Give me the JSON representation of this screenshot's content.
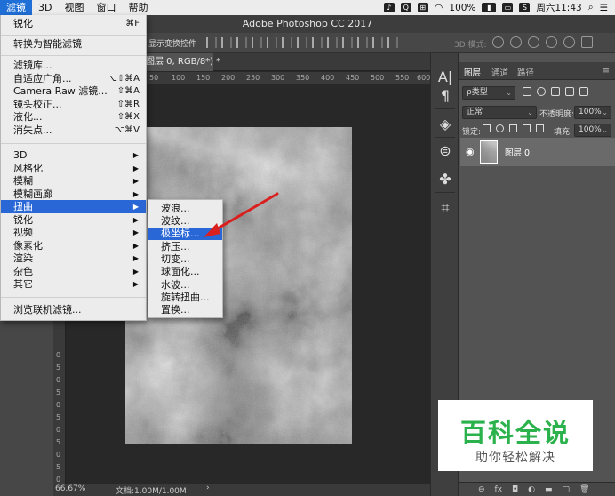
{
  "menubar": {
    "items": [
      {
        "label": "滤镜",
        "active": true
      },
      {
        "label": "3D",
        "active": false
      },
      {
        "label": "视图",
        "active": false
      },
      {
        "label": "窗口",
        "active": false
      },
      {
        "label": "帮助",
        "active": false
      }
    ],
    "battery": "100%",
    "clock": "周六11:43"
  },
  "window": {
    "title": "Adobe Photoshop CC 2017"
  },
  "options": {
    "show_transform": "显示变换控件",
    "mode_3d": "3D 模式:"
  },
  "document": {
    "tab_label": "图层 0, RGB/8*) *",
    "ruler_h": [
      "50",
      "100",
      "150",
      "200",
      "250",
      "300",
      "350",
      "400",
      "450",
      "500",
      "550",
      "600"
    ],
    "ruler_v": [
      "0",
      "5",
      "0",
      "5",
      "0",
      "5",
      "0",
      "5",
      "0",
      "5",
      "0"
    ],
    "zoom": "66.67%",
    "doc_size": "文档:1.00M/1.00M",
    "status_arrow": "›"
  },
  "filter_menu": {
    "items": [
      {
        "label": "锐化",
        "shortcut": "⌘F"
      },
      {
        "label": "转换为智能滤镜",
        "shortcut": ""
      },
      {
        "label": "滤镜库...",
        "shortcut": ""
      },
      {
        "label": "自适应广角...",
        "shortcut": "⌥⇧⌘A"
      },
      {
        "label": "Camera Raw 滤镜...",
        "shortcut": "⇧⌘A"
      },
      {
        "label": "镜头校正...",
        "shortcut": "⇧⌘R"
      },
      {
        "label": "液化...",
        "shortcut": "⇧⌘X"
      },
      {
        "label": "消失点...",
        "shortcut": "⌥⌘V"
      },
      {
        "label": "3D",
        "submenu": true
      },
      {
        "label": "风格化",
        "submenu": true
      },
      {
        "label": "模糊",
        "submenu": true
      },
      {
        "label": "模糊画廊",
        "submenu": true
      },
      {
        "label": "扭曲",
        "submenu": true,
        "highlighted": true
      },
      {
        "label": "锐化",
        "submenu": true
      },
      {
        "label": "视频",
        "submenu": true
      },
      {
        "label": "像素化",
        "submenu": true
      },
      {
        "label": "渲染",
        "submenu": true
      },
      {
        "label": "杂色",
        "submenu": true
      },
      {
        "label": "其它",
        "submenu": true
      },
      {
        "label": "浏览联机滤镜..."
      }
    ],
    "submenu_arrow": "▶"
  },
  "distort_submenu": {
    "items": [
      {
        "label": "波浪..."
      },
      {
        "label": "波纹..."
      },
      {
        "label": "极坐标...",
        "highlighted": true
      },
      {
        "label": "挤压..."
      },
      {
        "label": "切变..."
      },
      {
        "label": "球面化..."
      },
      {
        "label": "水波..."
      },
      {
        "label": "旋转扭曲..."
      },
      {
        "label": "置换..."
      }
    ]
  },
  "annotation": {
    "arrow_color": "#d9201f"
  },
  "layers_panel": {
    "tabs": [
      "图层",
      "通道",
      "路径"
    ],
    "menu_icon": "≡",
    "filter_kind": "ρ类型",
    "blend_mode": "正常",
    "opacity_label": "不透明度:",
    "opacity_value": "100%",
    "lock_label": "锁定:",
    "fill_label": "填充:",
    "fill_value": "100%",
    "layer_name": "图层 0",
    "footer_icons": [
      "⊖",
      "fx",
      "◘",
      "◐",
      "▬",
      "▢",
      "🗑"
    ]
  },
  "watermark": {
    "title": "百科全说",
    "subtitle": "助你轻松解决",
    "color": "#2bb24c"
  },
  "colors": {
    "highlight": "#2a67d6",
    "menu_bg": "#ececec",
    "ps_panel": "#535353"
  }
}
